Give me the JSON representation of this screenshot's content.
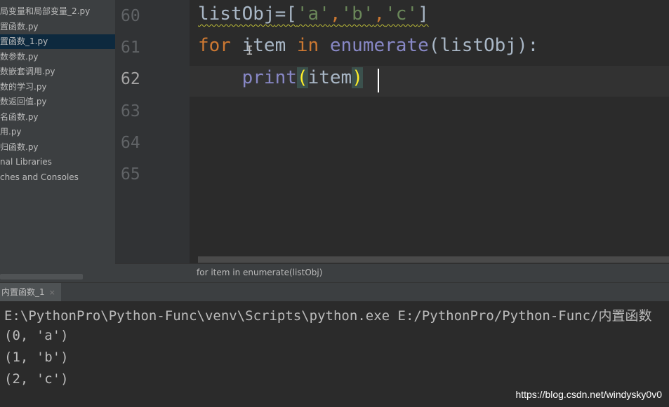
{
  "project_tree": {
    "items": [
      {
        "label": "局变量和局部变量_2.py",
        "selected": false
      },
      {
        "label": "置函数.py",
        "selected": false
      },
      {
        "label": "置函数_1.py",
        "selected": true
      },
      {
        "label": "数参数.py",
        "selected": false
      },
      {
        "label": "数嵌套调用.py",
        "selected": false
      },
      {
        "label": "数的学习.py",
        "selected": false
      },
      {
        "label": "数返回值.py",
        "selected": false
      },
      {
        "label": "名函数.py",
        "selected": false
      },
      {
        "label": "用.py",
        "selected": false
      },
      {
        "label": "归函数.py",
        "selected": false
      },
      {
        "label": "nal Libraries",
        "selected": false
      },
      {
        "label": "ches and Consoles",
        "selected": false
      }
    ]
  },
  "gutter": {
    "line_numbers": [
      "60",
      "61",
      "62",
      "63",
      "64",
      "65"
    ],
    "current_line": "62"
  },
  "editor": {
    "line60": {
      "var": "listObj",
      "eq": "=[",
      "s1": "'a'",
      "c1": ",",
      "s2": "'b'",
      "c2": ",",
      "s3": "'c'",
      "close": "]"
    },
    "line61": {
      "kw_for": "for",
      "mid1": " item ",
      "kw_in": "in",
      "mid2": " ",
      "fn": "enumerate",
      "rest": "(listObj):"
    },
    "line62": {
      "indent": "    ",
      "fn": "print",
      "open": "(",
      "arg": "item",
      "close": ")"
    }
  },
  "breadcrumb": "for item in enumerate(listObj)",
  "run": {
    "tab_label": "内置函数_1",
    "close_glyph": "×"
  },
  "console": {
    "lines": [
      "E:\\PythonPro\\Python-Func\\venv\\Scripts\\python.exe E:/PythonPro/Python-Func/内置函数",
      "(0, 'a')",
      "(1, 'b')",
      "(2, 'c')"
    ]
  },
  "watermark": "https://blog.csdn.net/windysky0v0",
  "colors": {
    "keyword": "#cc7832",
    "string": "#6a8759",
    "builtin": "#8888c6",
    "text": "#a9b7c6",
    "brace_match": "#ffef28"
  }
}
